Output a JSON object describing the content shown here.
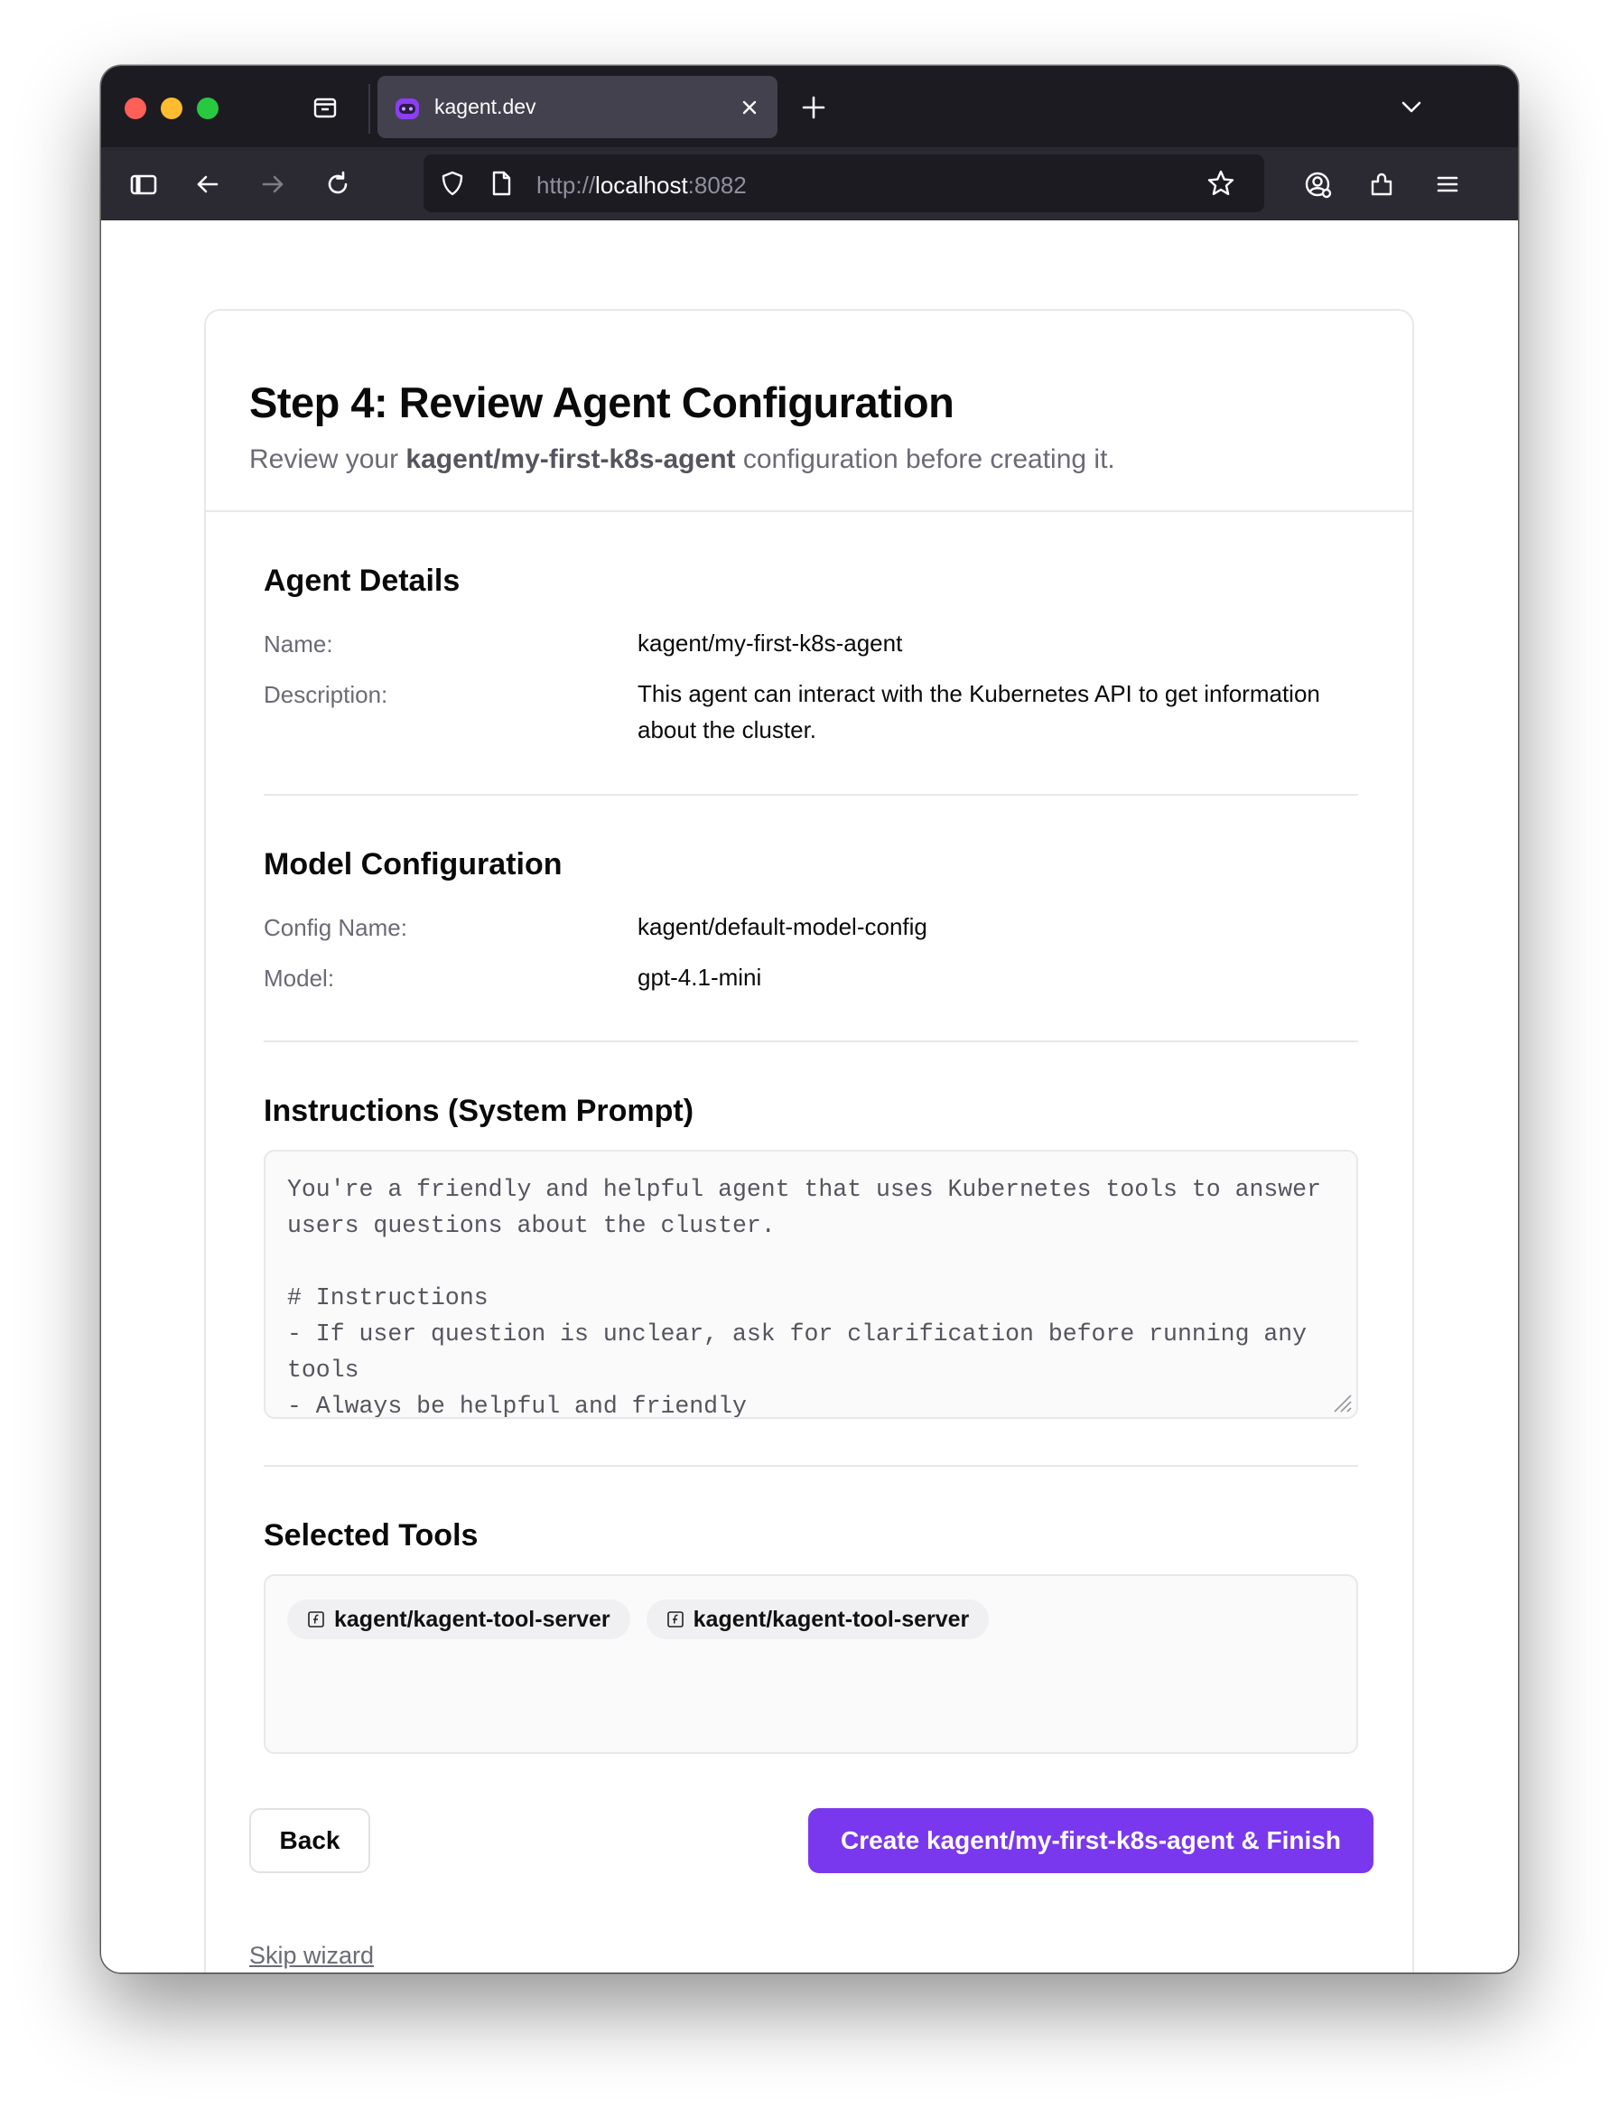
{
  "browser": {
    "tab": {
      "title": "kagent.dev",
      "favicon": "kagent-robot-icon"
    },
    "url": {
      "scheme": "http://",
      "host": "localhost",
      "port": ":8082"
    },
    "colors": {
      "tabbar": "#1c1b22",
      "navbar": "#2b2a33",
      "active_tab": "#42414d"
    }
  },
  "page": {
    "title": "Step 4: Review Agent Configuration",
    "subtitle": {
      "prefix": "Review your ",
      "agent_ref": "kagent/my-first-k8s-agent",
      "suffix": " configuration before creating it."
    },
    "agent_details": {
      "heading": "Agent Details",
      "name_label": "Name:",
      "name_value": "kagent/my-first-k8s-agent",
      "description_label": "Description:",
      "description_value": "This agent can interact with the Kubernetes API to get information about the cluster."
    },
    "model_configuration": {
      "heading": "Model Configuration",
      "config_name_label": "Config Name:",
      "config_name_value": "kagent/default-model-config",
      "model_label": "Model:",
      "model_value": "gpt-4.1-mini"
    },
    "instructions": {
      "heading": "Instructions (System Prompt)",
      "text": "You're a friendly and helpful agent that uses Kubernetes tools to answer users questions about the cluster.\n\n# Instructions\n- If user question is unclear, ask for clarification before running any tools\n- Always be helpful and friendly"
    },
    "selected_tools": {
      "heading": "Selected Tools",
      "tools": [
        {
          "label": "kagent/kagent-tool-server",
          "icon": "function-icon"
        },
        {
          "label": "kagent/kagent-tool-server",
          "icon": "function-icon"
        }
      ]
    },
    "actions": {
      "back_label": "Back",
      "create_label": "Create kagent/my-first-k8s-agent & Finish",
      "skip_label": "Skip wizard"
    },
    "colors": {
      "accent": "#7a38ee",
      "muted_text": "#6b6b76",
      "border": "#e8e8ea"
    }
  }
}
